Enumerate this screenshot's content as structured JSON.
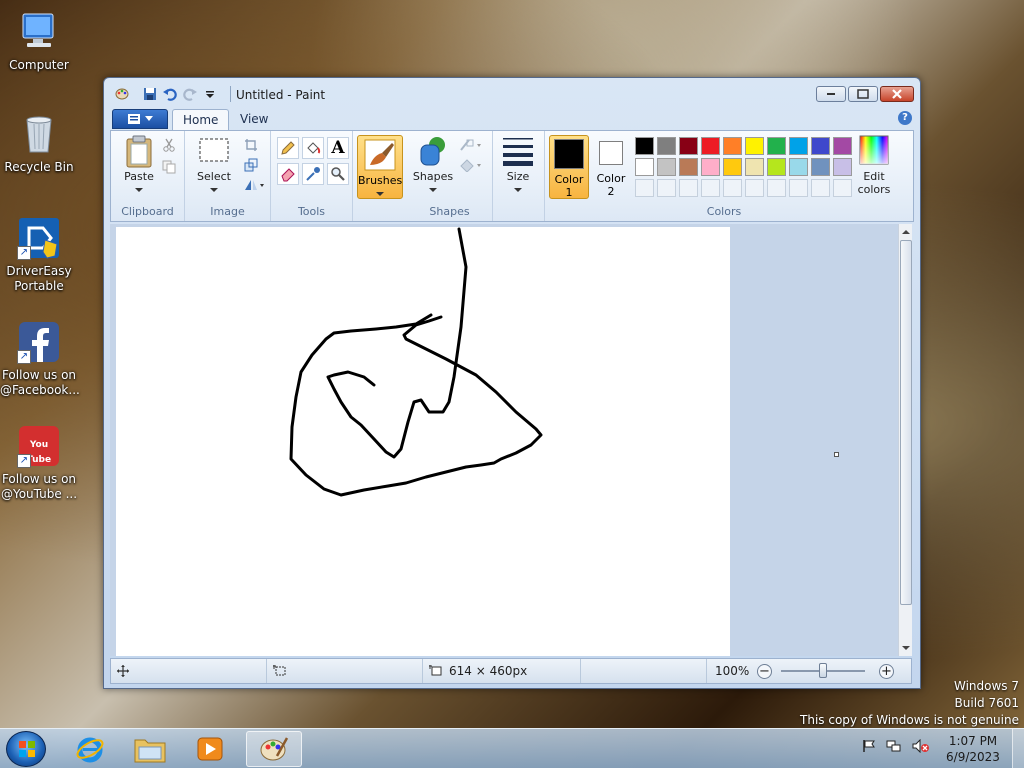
{
  "desktop": {
    "icons": [
      {
        "label": "Computer"
      },
      {
        "label": "Recycle Bin"
      },
      {
        "label": "DriverEasy Portable"
      },
      {
        "label": "Follow us on @Facebook..."
      },
      {
        "label": "Follow us on @YouTube ..."
      }
    ],
    "youtube_badge": "You Tube"
  },
  "window": {
    "title": "Untitled - Paint",
    "tabs": [
      {
        "label": "Home"
      },
      {
        "label": "View"
      }
    ],
    "help": "?"
  },
  "ribbon": {
    "clipboard": {
      "label": "Clipboard",
      "paste": "Paste"
    },
    "image": {
      "label": "Image",
      "select": "Select"
    },
    "tools": {
      "label": "Tools",
      "text_glyph": "A"
    },
    "brushes": {
      "label": "Brushes"
    },
    "shapes": {
      "label": "Shapes",
      "button": "Shapes"
    },
    "size": {
      "label": "Size"
    },
    "colors": {
      "label": "Colors",
      "color1_label": "Color 1",
      "color1_line1": "Color",
      "color1_line2": "1",
      "color2_label": "Color 2",
      "color2_line1": "Color",
      "color2_line2": "2",
      "color1": "#000000",
      "color2": "#ffffff",
      "edit_line1": "Edit",
      "edit_line2": "colors",
      "palette_row1": [
        "#000000",
        "#7f7f7f",
        "#880015",
        "#ed1c24",
        "#ff7f27",
        "#fff200",
        "#22b14c",
        "#00a2e8",
        "#3f48cc",
        "#a349a4"
      ],
      "palette_row2": [
        "#ffffff",
        "#c3c3c3",
        "#b97a57",
        "#ffaec9",
        "#ffc90e",
        "#efe4b0",
        "#b5e61d",
        "#99d9ea",
        "#7092be",
        "#c8bfe7"
      ]
    }
  },
  "status": {
    "canvas_size": "614 × 460px",
    "zoom": "100%",
    "zoom_level": 1.0
  },
  "watermark": {
    "line1": "Windows 7",
    "line2": "Build 7601",
    "line3": "This copy of Windows is not genuine"
  },
  "taskbar": {
    "time": "1:07 PM",
    "date": "6/9/2023"
  },
  "colors": {
    "accent": "#1b4fa3",
    "selected_tool_bg": "#f7b440"
  }
}
